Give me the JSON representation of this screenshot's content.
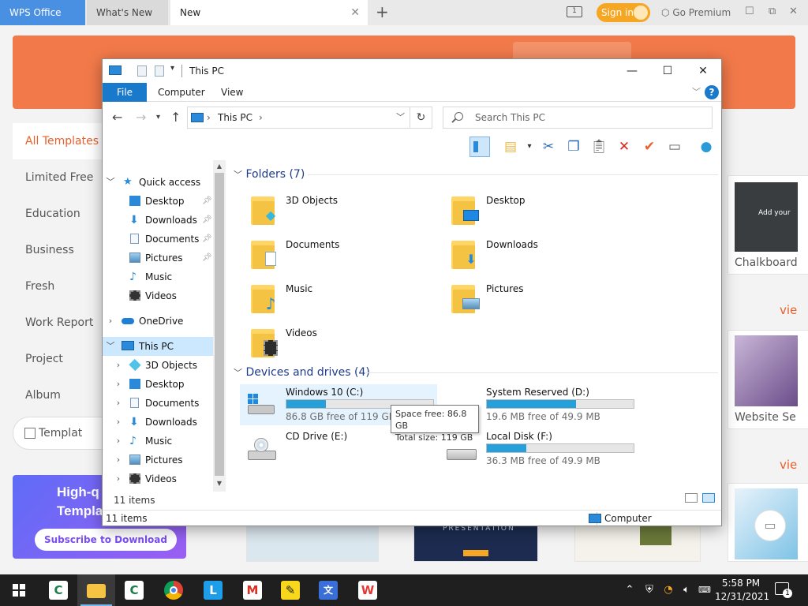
{
  "wps": {
    "tabs": [
      {
        "label": "WPS Office"
      },
      {
        "label": "What's New"
      },
      {
        "label": "New"
      }
    ],
    "tab_close": "✕",
    "tab_add": "+",
    "signin_label": "Sign in",
    "premium_label": "Go Premium",
    "categories": [
      "All Templates",
      "Limited Free",
      "Education",
      "Business",
      "Fresh",
      "Work Report",
      "Project",
      "Album"
    ],
    "template_btn_label": "Templat",
    "promo": {
      "title_line1": "High-q",
      "title_line2": "Templat",
      "button": "Subscribe to Download"
    },
    "cards": [
      {
        "label": "Chalkboard",
        "preview_text": "Add   your"
      },
      {
        "label": "Website Se"
      }
    ],
    "view_more": [
      "vie",
      "vie"
    ],
    "presentation_text": "PRESENTATION"
  },
  "explorer": {
    "title": "This PC",
    "window_buttons": {
      "minimize": "—",
      "maximize": "☐",
      "close": "✕"
    },
    "ribbon": {
      "file": "File",
      "tabs": [
        "Computer",
        "View"
      ],
      "help": "?"
    },
    "address": {
      "path": "This PC"
    },
    "search": {
      "placeholder": "Search This PC"
    },
    "nav": {
      "quick_access": "Quick access",
      "quick_items": [
        "Desktop",
        "Downloads",
        "Documents",
        "Pictures",
        "Music",
        "Videos"
      ],
      "onedrive": "OneDrive",
      "this_pc": "This PC",
      "pc_items": [
        "3D Objects",
        "Desktop",
        "Documents",
        "Downloads",
        "Music",
        "Pictures",
        "Videos"
      ],
      "item_count": "11 items"
    },
    "content": {
      "folders_header": "Folders (7)",
      "folders": [
        {
          "name": "3D Objects",
          "icon": "cube-icon"
        },
        {
          "name": "Desktop",
          "icon": "desktop-icon"
        },
        {
          "name": "Documents",
          "icon": "document-icon"
        },
        {
          "name": "Downloads",
          "icon": "download-arrow-icon"
        },
        {
          "name": "Music",
          "icon": "music-note-icon"
        },
        {
          "name": "Pictures",
          "icon": "picture-icon"
        },
        {
          "name": "Videos",
          "icon": "film-icon"
        }
      ],
      "devices_header": "Devices and drives (4)",
      "drives": [
        {
          "name": "Windows 10 (C:)",
          "free": "86.8 GB free of 119 GB",
          "used_fraction": 0.27,
          "icon": "windows-drive-icon"
        },
        {
          "name": "System Reserved (D:)",
          "free": "19.6 MB free of 49.9 MB",
          "used_fraction": 0.61,
          "icon": "hard-drive-icon"
        },
        {
          "name": "CD Drive (E:)",
          "free": "",
          "used_fraction": null,
          "icon": "cd-drive-icon"
        },
        {
          "name": "Local Disk (F:)",
          "free": "36.3 MB free of 49.9 MB",
          "used_fraction": 0.27,
          "icon": "hard-drive-icon"
        }
      ],
      "tooltip": {
        "line1": "Space free: 86.8 GB",
        "line2": "Total size: 119 GB"
      }
    },
    "status": {
      "items": "11 items",
      "location": "Computer"
    }
  },
  "taskbar": {
    "time": "5:58 PM",
    "date": "12/31/2021",
    "notification_count": "1"
  },
  "colors": {
    "wps_orange": "#f27a4a",
    "wps_accent": "#e8602c",
    "explorer_blue": "#1979ca",
    "drive_fill": "#26a0da",
    "selection": "#cce8ff"
  }
}
